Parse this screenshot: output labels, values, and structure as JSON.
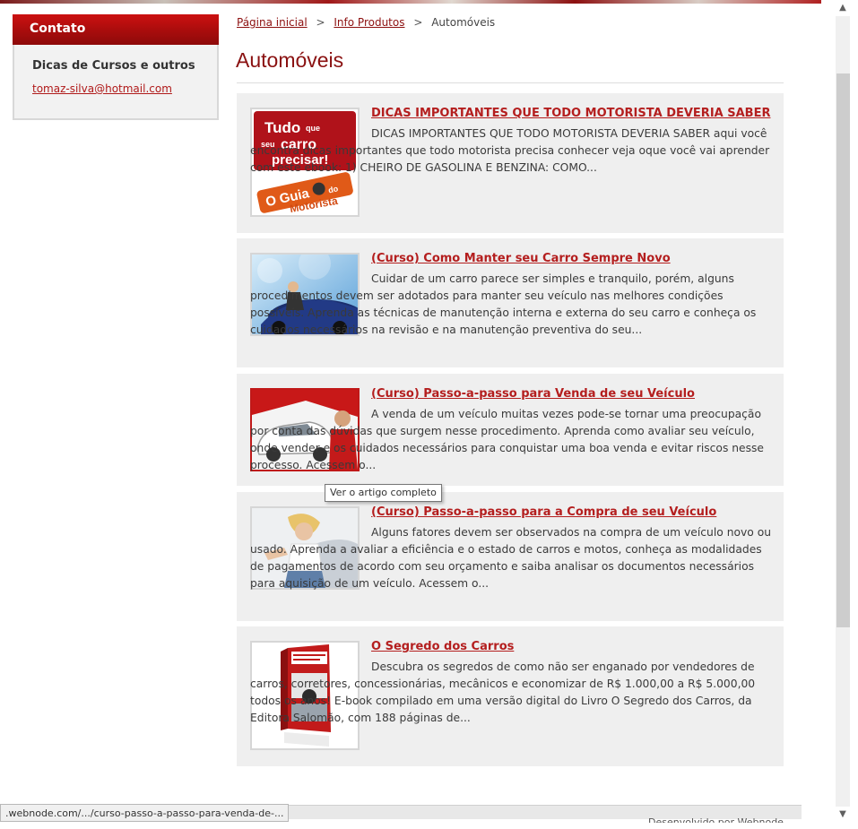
{
  "sidebar": {
    "heading": "Contato",
    "text": "Dicas de Cursos e outros",
    "email": "tomaz-silva@hotmail.com"
  },
  "breadcrumb": {
    "home": "Página inicial",
    "section": "Info Produtos",
    "current": "Automóveis",
    "separator": ">"
  },
  "page_title": "Automóveis",
  "articles": [
    {
      "title": "DICAS IMPORTANTES QUE TODO MOTORISTA DEVERIA SABER",
      "text": "DICAS IMPORTANTES QUE TODO MOTORISTA DEVERIA SABER     aqui você encontra dicas importantes que todo motorista precisa conhecer   veja oque você vai aprender com este ebook:   1) CHEIRO DE GASOLINA E BENZINA: COMO...",
      "image_text_1": "Tudo que seu carro precisar!",
      "image_text_2": "O Guia do Motorista"
    },
    {
      "title": "(Curso) Como Manter seu Carro Sempre Novo",
      "text": "Cuidar de um carro parece ser simples e tranquilo, porém, alguns procedimentos devem ser adotados para manter seu veículo nas melhores condições possíveis. Aprenda as técnicas de manutenção interna e externa do seu carro e conheça os cuidados necessários na revisão e na manutenção preventiva do seu..."
    },
    {
      "title": "(Curso) Passo-a-passo para Venda de seu Veículo",
      "text": "A venda de um veículo muitas vezes pode-se tornar uma preocupação por conta das dúvidas que surgem nesse procedimento.  Aprenda como avaliar seu veículo, onde vender e os cuidados necessários para conquistar uma boa venda e evitar riscos nesse processo. Acessem o..."
    },
    {
      "title": "(Curso) Passo-a-passo para a Compra de seu Veículo",
      "text": "Alguns fatores devem ser observados na compra de um veículo novo ou usado. Aprenda a avaliar a eficiência e o estado de carros e motos, conheça as modalidades de pagamentos de acordo com seu orçamento e saiba analisar os documentos necessários para aquisição de um veículo. Acessem o..."
    },
    {
      "title": "O Segredo dos Carros",
      "text": "Descubra os segredos de como não ser enganado por vendedores de carros, corretores, concessionárias, mecânicos e economizar de R$ 1.000,00 a R$ 5.000,00 todos os anos!   E-book compilado em uma versão digital do Livro O Segredo dos Carros, da Editora Salomão, com 188 páginas de..."
    }
  ],
  "tooltip": "Ver o artigo completo",
  "status_url": ".webnode.com/.../curso-passo-a-passo-para-venda-de-...",
  "footer_credit": "Desenvolvido por Webnode",
  "colors": {
    "accent": "#b41e1e",
    "title_red": "#8a1111",
    "card_bg": "#efefef",
    "header_red": "#a50c0c"
  }
}
